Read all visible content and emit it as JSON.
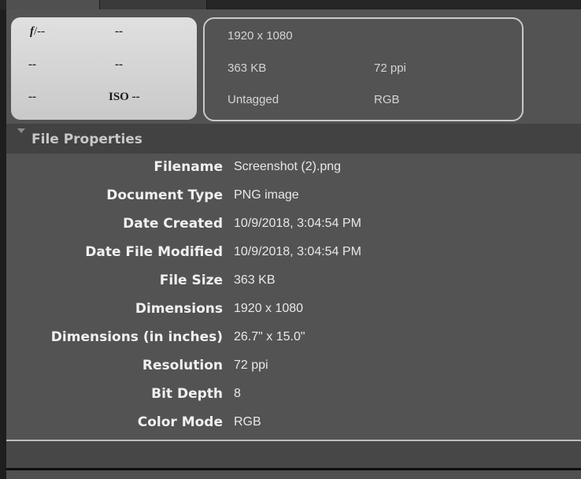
{
  "camera": {
    "fstop_symbol": "f",
    "fstop_value": "/--",
    "shutter": "--",
    "r2c1": "--",
    "r2c2": "--",
    "r3c1": "--",
    "iso": "ISO --"
  },
  "image_info": {
    "dimensions": "1920 x 1080",
    "size": "363 KB",
    "resolution": "72 ppi",
    "profile": "Untagged",
    "mode": "RGB"
  },
  "section": {
    "title": "File Properties"
  },
  "properties": [
    {
      "label": "Filename",
      "value": "Screenshot (2).png"
    },
    {
      "label": "Document Type",
      "value": "PNG image"
    },
    {
      "label": "Date Created",
      "value": "10/9/2018, 3:04:54 PM"
    },
    {
      "label": "Date File Modified",
      "value": "10/9/2018, 3:04:54 PM"
    },
    {
      "label": "File Size",
      "value": "363 KB"
    },
    {
      "label": "Dimensions",
      "value": "1920 x 1080"
    },
    {
      "label": "Dimensions (in inches)",
      "value": "26.7\" x 15.0\""
    },
    {
      "label": "Resolution",
      "value": "72 ppi"
    },
    {
      "label": "Bit Depth",
      "value": "8"
    },
    {
      "label": "Color Mode",
      "value": "RGB"
    }
  ]
}
